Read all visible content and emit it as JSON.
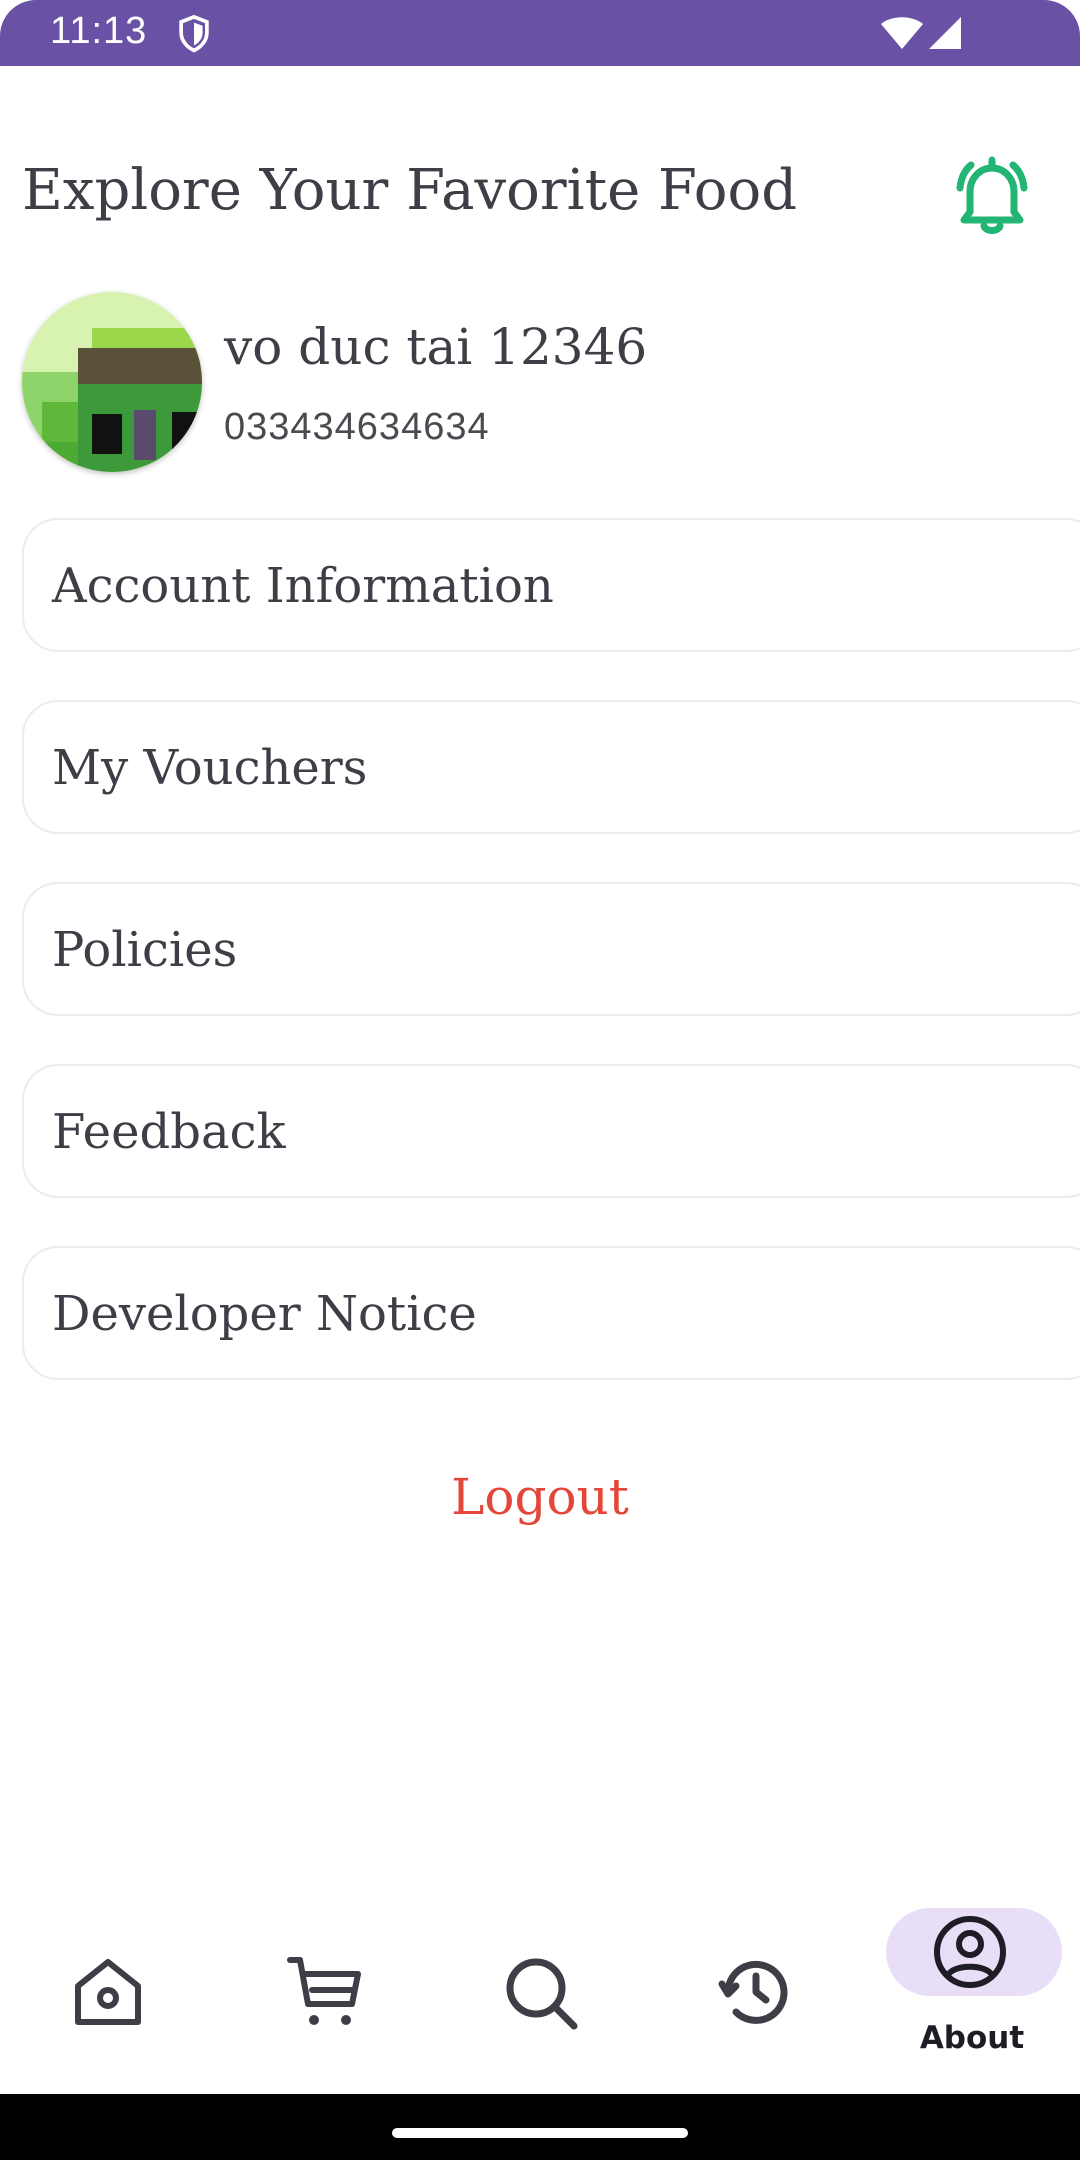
{
  "status_bar": {
    "time": "11:13",
    "background": "#6952a6"
  },
  "header": {
    "title": "Explore Your Favorite Food",
    "notification_icon": "bell-ringing-icon",
    "accent": "#22b573"
  },
  "profile": {
    "name": "vo duc tai 12346",
    "phone": "033434634634",
    "avatar_icon": "pixel-art-avatar"
  },
  "menu": {
    "items": [
      {
        "label": "Account Information"
      },
      {
        "label": "My Vouchers"
      },
      {
        "label": "Policies"
      },
      {
        "label": "Feedback"
      },
      {
        "label": "Developer Notice"
      }
    ]
  },
  "logout": {
    "label": "Logout",
    "color": "#e4463a"
  },
  "bottom_nav": {
    "items": [
      {
        "icon": "home-icon",
        "label": ""
      },
      {
        "icon": "cart-icon",
        "label": ""
      },
      {
        "icon": "search-icon",
        "label": ""
      },
      {
        "icon": "history-icon",
        "label": ""
      },
      {
        "icon": "account-circle-icon",
        "label": "About",
        "active": true
      }
    ],
    "active_pill_color": "#e9def8"
  }
}
